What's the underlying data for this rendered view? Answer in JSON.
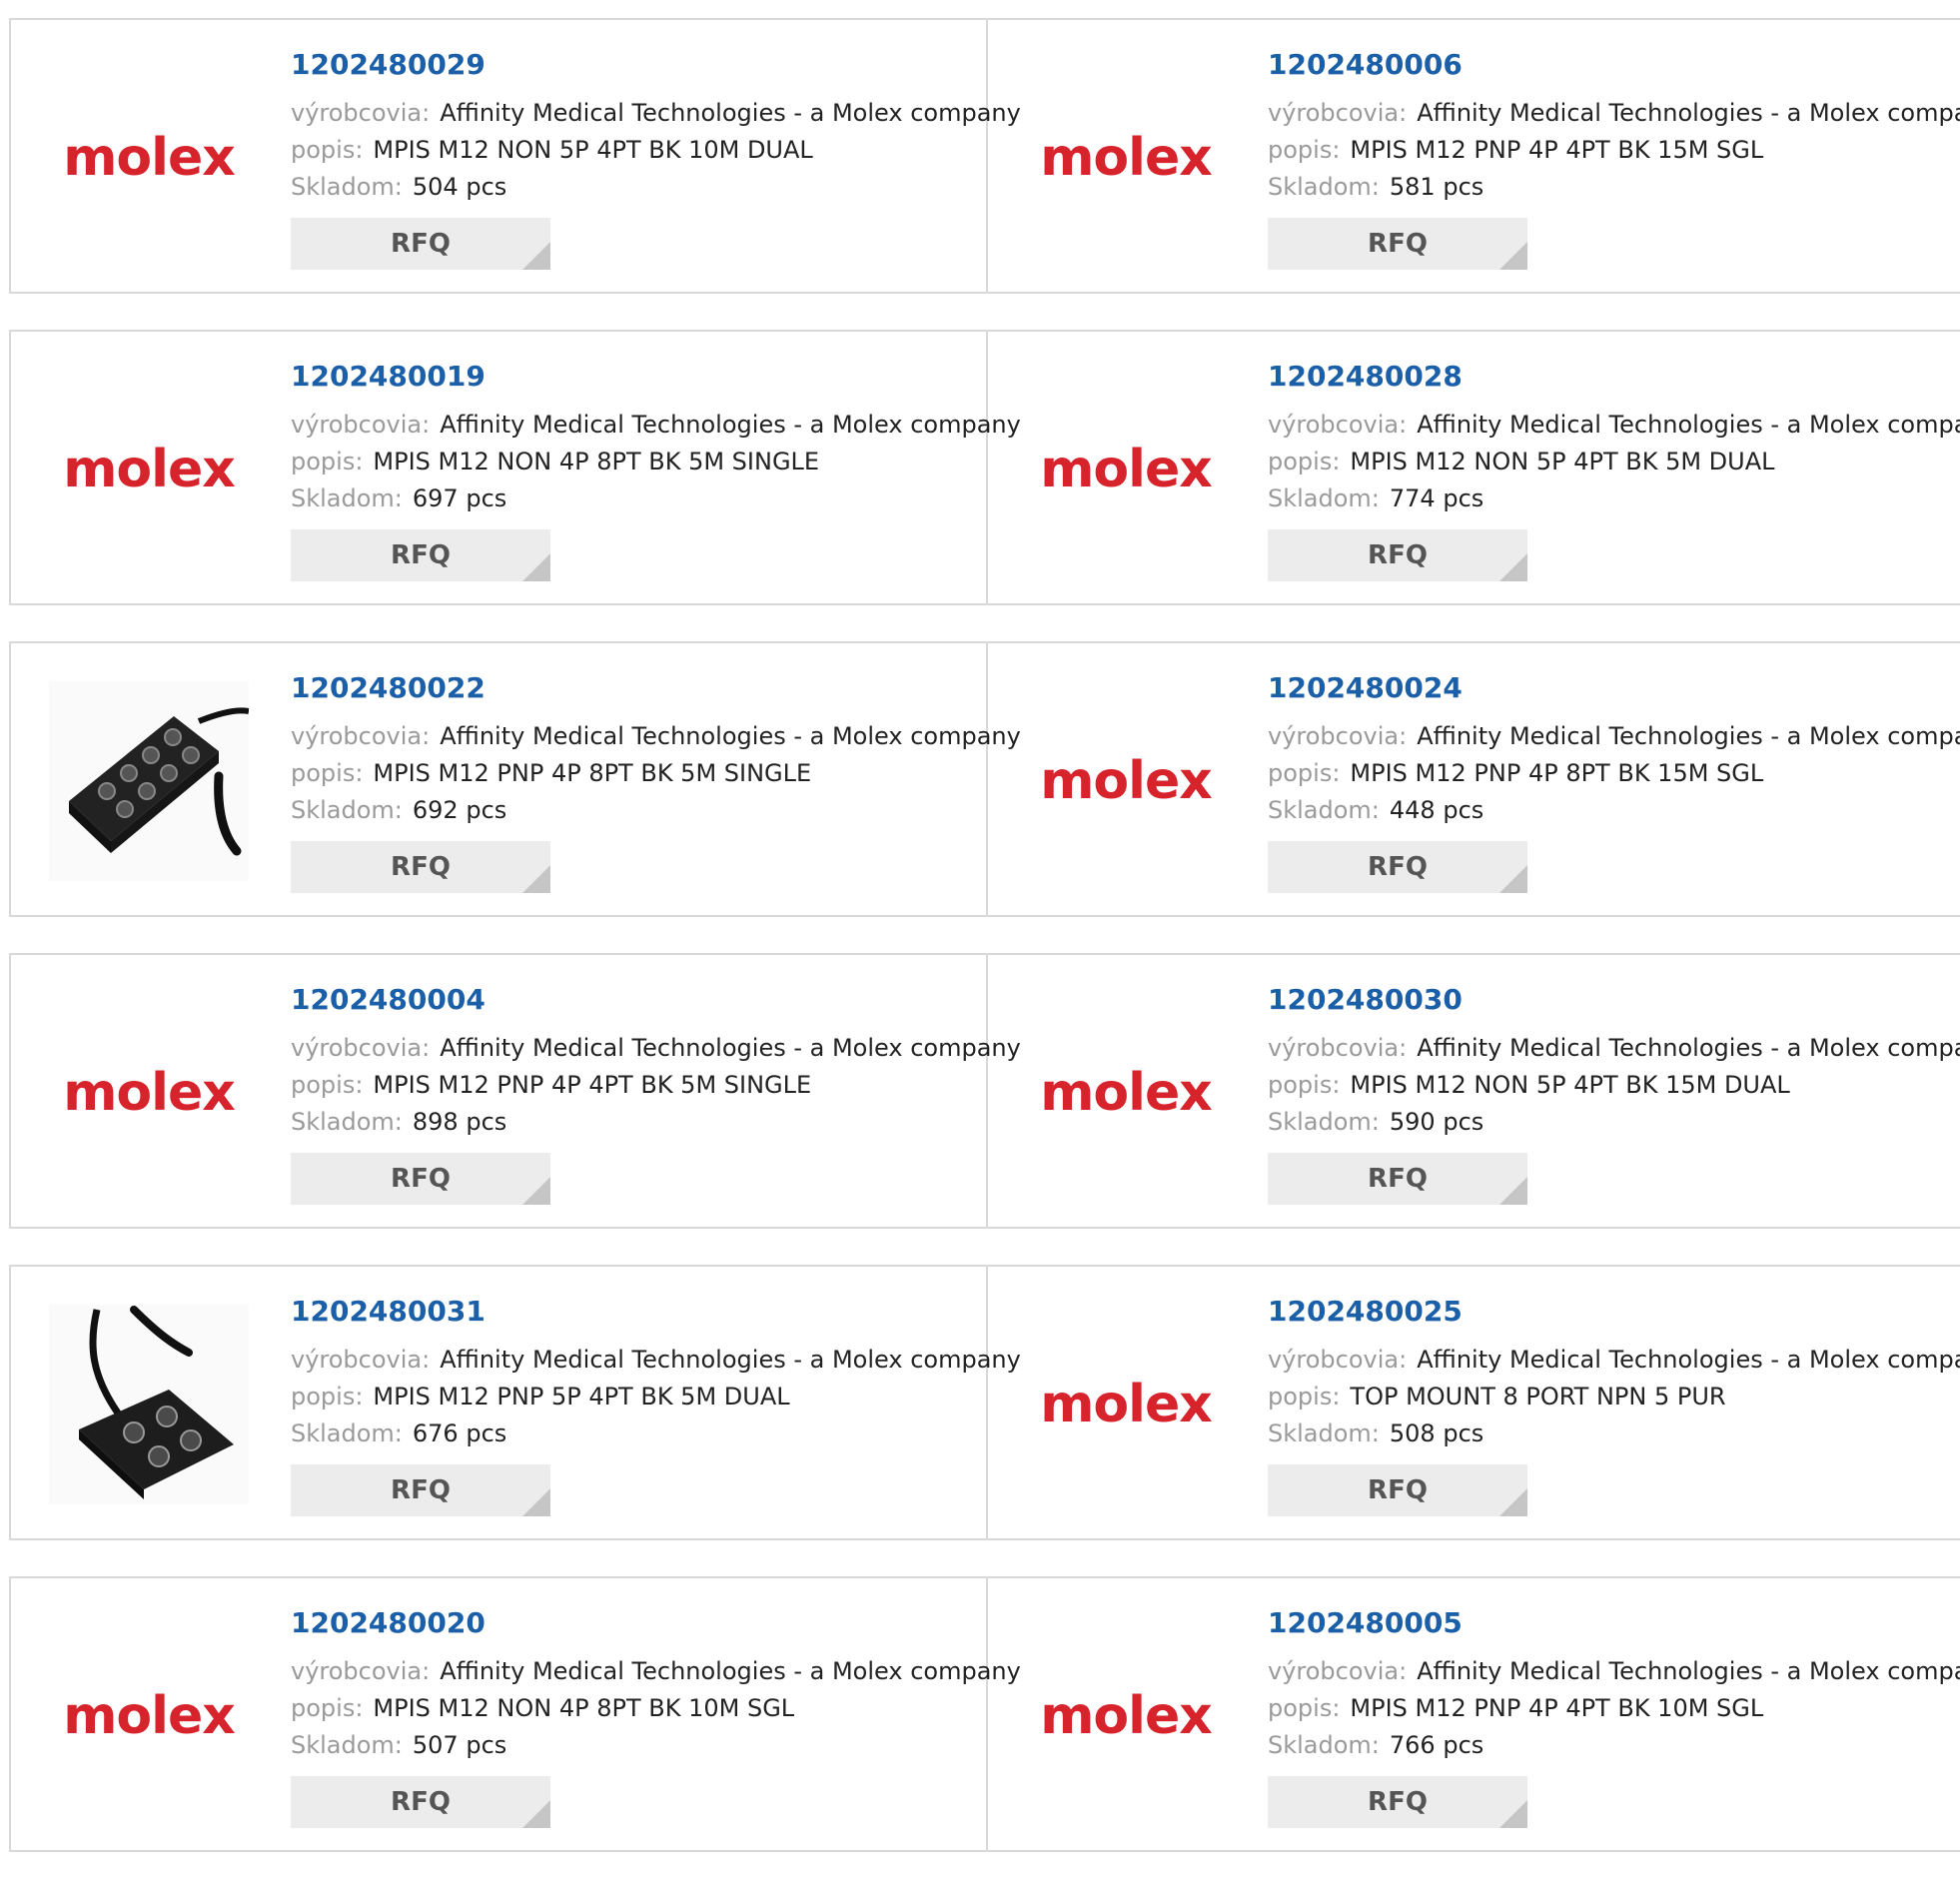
{
  "labels": {
    "manufacturer": "výrobcovia:",
    "description": "popis:",
    "stock": "Skladom:",
    "rfq": "RFQ"
  },
  "logo_text": "molex",
  "colors": {
    "part_number": "#1a5fa8",
    "logo": "#d7232b",
    "label": "#9a9a9a"
  },
  "products": [
    {
      "part": "1202480029",
      "image": "molex-logo",
      "manufacturer": "Affinity Medical Technologies - a Molex company",
      "description": "MPIS M12 NON 5P 4PT BK 10M DUAL",
      "stock": "504 pcs"
    },
    {
      "part": "1202480006",
      "image": "molex-logo",
      "manufacturer": "Affinity Medical Technologies - a Molex company",
      "description": "MPIS M12 PNP 4P 4PT BK 15M SGL",
      "stock": "581 pcs"
    },
    {
      "part": "1202480019",
      "image": "molex-logo",
      "manufacturer": "Affinity Medical Technologies - a Molex company",
      "description": "MPIS M12 NON 4P 8PT BK 5M SINGLE",
      "stock": "697 pcs"
    },
    {
      "part": "1202480028",
      "image": "molex-logo",
      "manufacturer": "Affinity Medical Technologies - a Molex company",
      "description": "MPIS M12 NON 5P 4PT BK 5M DUAL",
      "stock": "774 pcs"
    },
    {
      "part": "1202480022",
      "image": "connector-box-8-port-photo",
      "manufacturer": "Affinity Medical Technologies - a Molex company",
      "description": "MPIS M12 PNP 4P 8PT BK 5M SINGLE",
      "stock": "692 pcs"
    },
    {
      "part": "1202480024",
      "image": "molex-logo",
      "manufacturer": "Affinity Medical Technologies - a Molex company",
      "description": "MPIS M12 PNP 4P 8PT BK 15M SGL",
      "stock": "448 pcs"
    },
    {
      "part": "1202480004",
      "image": "molex-logo",
      "manufacturer": "Affinity Medical Technologies - a Molex company",
      "description": "MPIS M12 PNP 4P 4PT BK 5M SINGLE",
      "stock": "898 pcs"
    },
    {
      "part": "1202480030",
      "image": "molex-logo",
      "manufacturer": "Affinity Medical Technologies - a Molex company",
      "description": "MPIS M12 NON 5P 4PT BK 15M DUAL",
      "stock": "590 pcs"
    },
    {
      "part": "1202480031",
      "image": "connector-box-4-port-photo",
      "manufacturer": "Affinity Medical Technologies - a Molex company",
      "description": "MPIS M12 PNP 5P 4PT BK 5M DUAL",
      "stock": "676 pcs"
    },
    {
      "part": "1202480025",
      "image": "molex-logo",
      "manufacturer": "Affinity Medical Technologies - a Molex company",
      "description": "TOP MOUNT 8 PORT NPN 5 PUR",
      "stock": "508 pcs"
    },
    {
      "part": "1202480020",
      "image": "molex-logo",
      "manufacturer": "Affinity Medical Technologies - a Molex company",
      "description": "MPIS M12 NON 4P 8PT BK 10M SGL",
      "stock": "507 pcs"
    },
    {
      "part": "1202480005",
      "image": "molex-logo",
      "manufacturer": "Affinity Medical Technologies - a Molex company",
      "description": "MPIS M12 PNP 4P 4PT BK 10M SGL",
      "stock": "766 pcs"
    }
  ]
}
